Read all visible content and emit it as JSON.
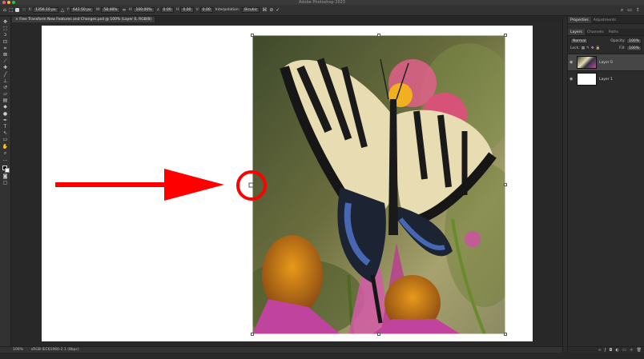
{
  "window": {
    "title": "Adobe Photoshop 2023"
  },
  "options_bar": {
    "x_value": "1356.10 px",
    "y_value": "642.50 px",
    "w_label": "W:",
    "w_value": "58.48%",
    "h_label": "H:",
    "h_value": "100.00%",
    "angle_value": "0.00",
    "h_skew_label": "H:",
    "h_skew_value": "0.00",
    "v_skew_label": "V:",
    "v_skew_value": "0.00",
    "interpolation_label": "Interpolation:",
    "interpolation_value": "Bicubic"
  },
  "document": {
    "tab_title": "Free Transform New Features and Changes.psd @ 100% (Layer 0, RGB/8)"
  },
  "status_bar": {
    "zoom": "100%",
    "profile": "sRGB IEC61966-2.1 (8bpc)"
  },
  "panels": {
    "top_tabs": [
      "Properties",
      "Adjustments"
    ],
    "layer_tabs": [
      "Layers",
      "Channels",
      "Paths"
    ],
    "blend_mode": "Normal",
    "opacity_label": "Opacity:",
    "opacity_value": "100%",
    "lock_label": "Lock:",
    "fill_label": "Fill:",
    "fill_value": "100%",
    "layers": [
      {
        "name": "Layer 0"
      },
      {
        "name": "Layer 1"
      }
    ]
  },
  "colors": {
    "arrow": "#ff0000",
    "canvas_bg": "#282828",
    "panel_bg": "#2b2b2b"
  }
}
